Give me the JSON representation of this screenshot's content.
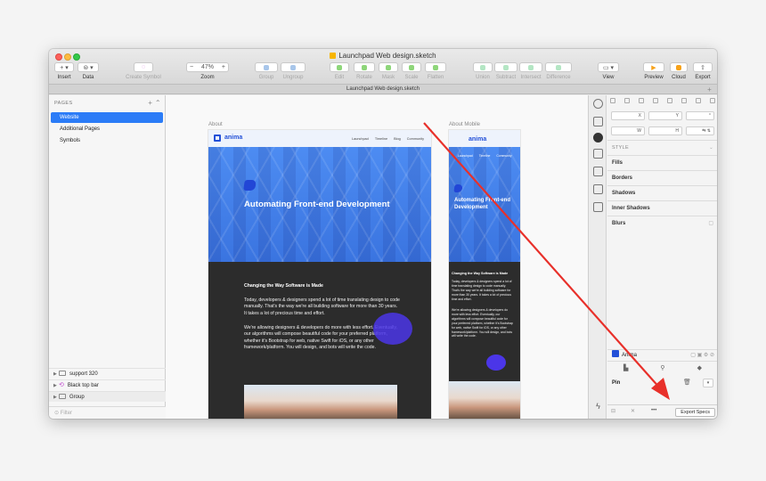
{
  "window": {
    "title": "Launchpad Web design.sketch",
    "tab": "Launchpad Web design.sketch"
  },
  "toolbar": {
    "insert": "Insert",
    "data": "Data",
    "create_symbol": "Create Symbol",
    "zoom_label": "Zoom",
    "zoom_value": "47%",
    "group": "Group",
    "ungroup": "Ungroup",
    "edit": "Edit",
    "rotate": "Rotate",
    "mask": "Mask",
    "scale": "Scale",
    "flatten": "Flatten",
    "union": "Union",
    "subtract": "Subtract",
    "intersect": "Intersect",
    "difference": "Difference",
    "view": "View",
    "preview": "Preview",
    "cloud": "Cloud",
    "export": "Export"
  },
  "pages": {
    "header": "PAGES",
    "items": [
      "Website",
      "Additional Pages",
      "Symbols"
    ],
    "active_index": 0
  },
  "layers": [
    {
      "name": "support 320",
      "kind": "artboard"
    },
    {
      "name": "Black top bar",
      "kind": "symbol"
    },
    {
      "name": "Group",
      "kind": "group"
    }
  ],
  "filter_placeholder": "Filter",
  "canvas": {
    "artboard_main_label": "About",
    "artboard_mobile_label": "About Mobile",
    "brand": "anima",
    "nav_links": [
      "Launchpad",
      "Timeline",
      "Blog",
      "Community"
    ],
    "hero_title": "Automating Front-end Development",
    "mobile_hero_title": "Automating Front-end Development",
    "section_title": "Changing the Way Software is Made",
    "paragraph_1": "Today, developers & designers spend a lot of time translating design to code manually. That's the way we're all building software for more than 30 years. It takes a lot of precious time and effort.",
    "paragraph_2": "We're allowing designers & developers do more with less effort. Eventually, our algorithms will compose beautiful code for your preferred platform, whether it's Bootstrap for web, native Swift for iOS, or any other framework/platform. You will design, and bots will write the code."
  },
  "inspector": {
    "x_label": "X",
    "y_label": "Y",
    "w_label": "W",
    "h_label": "H",
    "style_header": "STYLE",
    "fills": "Fills",
    "borders": "Borders",
    "shadows": "Shadows",
    "inner_shadows": "Inner Shadows",
    "blurs": "Blurs",
    "symbol_name": "Anima",
    "pin_label": "Pin",
    "more": "•••",
    "export_specs": "Export Specs"
  },
  "annotation": {
    "arrow_color": "#e8302a"
  },
  "colors": {
    "accent": "#2b7cf7",
    "brand_blue": "#2350d8",
    "hero_blue": "#3d7be8",
    "dark_section": "#2c2c2c",
    "blob_purple": "#4b36e8"
  }
}
